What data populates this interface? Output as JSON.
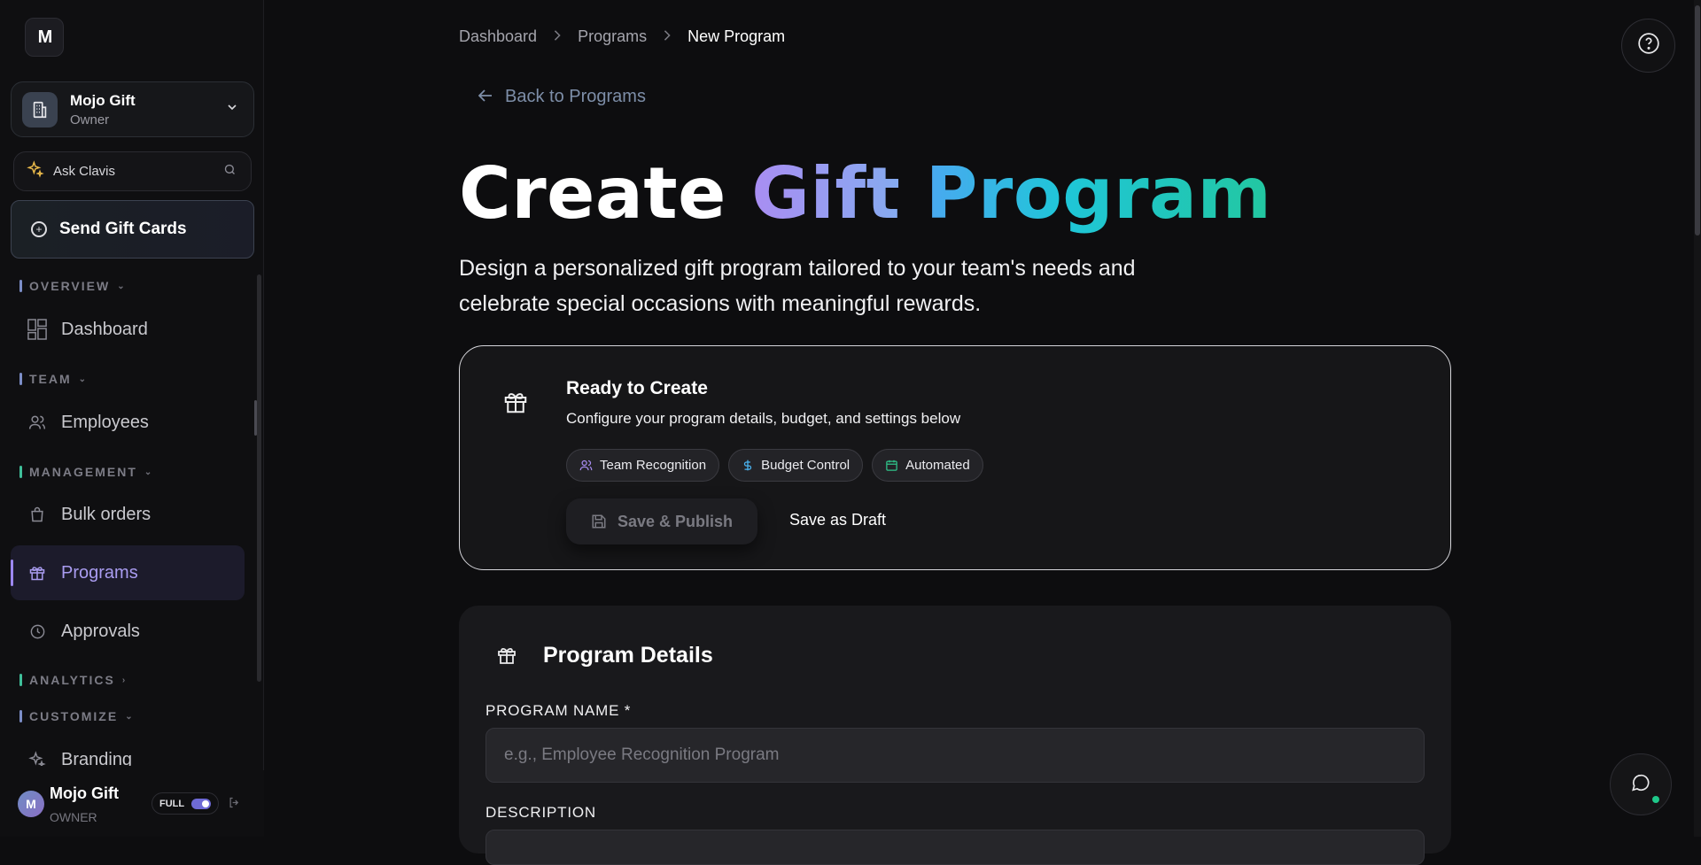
{
  "sidebar": {
    "logo_text": "M",
    "org": {
      "name": "Mojo Gift",
      "role": "Owner"
    },
    "ask": {
      "label": "Ask Clavis"
    },
    "send_button": "Send Gift Cards",
    "sections": [
      {
        "label": "OVERVIEW",
        "color": "#7c8ec8"
      },
      {
        "label": "TEAM",
        "color": "#7c8ec8"
      },
      {
        "label": "MANAGEMENT",
        "color": "#3fbf9a"
      },
      {
        "label": "ANALYTICS",
        "color": "#3fbf9a"
      },
      {
        "label": "CUSTOMIZE",
        "color": "#7c8ec8"
      }
    ],
    "items": [
      {
        "label": "Dashboard",
        "icon": "layout-icon"
      },
      {
        "label": "Employees",
        "icon": "users-icon"
      },
      {
        "label": "Bulk orders",
        "icon": "bag-icon"
      },
      {
        "label": "Programs",
        "icon": "gift-icon",
        "active": true
      },
      {
        "label": "Approvals",
        "icon": "clock-icon"
      },
      {
        "label": "Branding",
        "icon": "sparkle-icon"
      }
    ],
    "user": {
      "initial": "M",
      "name": "Mojo Gift",
      "role": "OWNER",
      "mode": "FULL"
    }
  },
  "breadcrumb": [
    "Dashboard",
    "Programs",
    "New Program"
  ],
  "back_link": "Back to Programs",
  "title": {
    "part1": "Create ",
    "part2": "Gift ",
    "part3": "Program"
  },
  "subtitle": "Design a personalized gift program tailored to your team's needs and celebrate special occasions with meaningful rewards.",
  "ready_card": {
    "title": "Ready to Create",
    "description": "Configure your program details, budget, and settings below",
    "chips": [
      {
        "label": "Team Recognition",
        "icon": "users-icon",
        "color": "#a98df2"
      },
      {
        "label": "Budget Control",
        "icon": "dollar-icon",
        "color": "#4ab3f0"
      },
      {
        "label": "Automated",
        "icon": "calendar-icon",
        "color": "#2fc48a"
      }
    ],
    "publish_button": "Save & Publish",
    "draft_button": "Save as Draft"
  },
  "details_card": {
    "title": "Program Details",
    "name_label": "PROGRAM NAME *",
    "name_placeholder": "e.g., Employee Recognition Program",
    "description_label": "DESCRIPTION"
  }
}
